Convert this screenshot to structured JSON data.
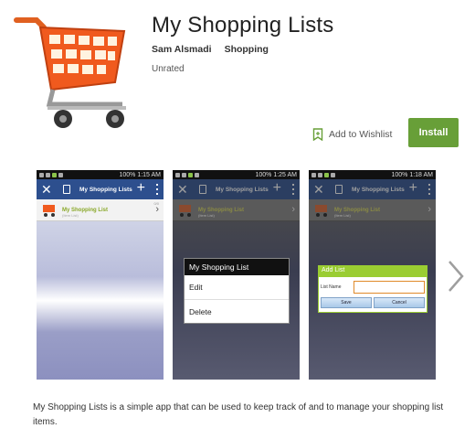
{
  "app": {
    "title": "My Shopping Lists",
    "developer": "Sam Alsmadi",
    "category": "Shopping",
    "rating": "Unrated",
    "icon": "shopping-cart-icon"
  },
  "actions": {
    "wishlist_label": "Add to Wishlist",
    "install_label": "Install",
    "install_color": "#689f38"
  },
  "screenshots": [
    {
      "status_time": "1:15 AM",
      "battery": "100%",
      "toolbar_title": "My Shopping Lists",
      "list_item_name": "My Shopping List",
      "list_item_sub": "(Item List)",
      "list_item_count": "0/0"
    },
    {
      "status_time": "1:25 AM",
      "battery": "100%",
      "toolbar_title": "My Shopping Lists",
      "list_item_name": "My Shopping List",
      "list_item_sub": "(Item List)",
      "menu_title": "My Shopping List",
      "menu_items": [
        "Edit",
        "Delete"
      ]
    },
    {
      "status_time": "1:18 AM",
      "battery": "100%",
      "toolbar_title": "My Shopping Lists",
      "list_item_name": "My Shopping List",
      "list_item_sub": "(Item List)",
      "dialog_title": "Add List",
      "field_label": "List Name",
      "save_label": "Save",
      "cancel_label": "Cancel"
    }
  ],
  "description": "My Shopping Lists is a simple app that can be used to keep track of and to manage your shopping list items.",
  "colors": {
    "brand_green": "#689f38",
    "actionbar_blue": "#2d4f8e",
    "dialog_green": "#9acd32"
  }
}
